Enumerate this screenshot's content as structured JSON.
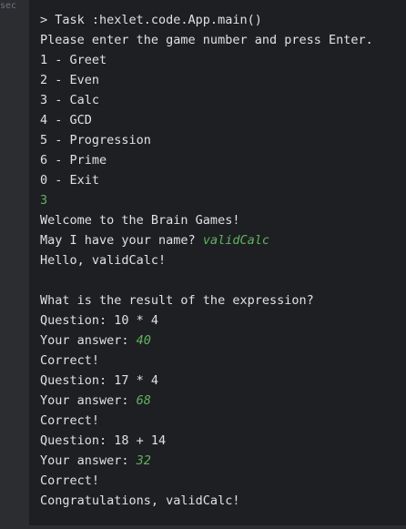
{
  "gutter": {
    "label": "sec"
  },
  "colors": {
    "background": "#1e1f22",
    "gutter": "#2b2d30",
    "text": "#dfe1e5",
    "user_input": "#5fb35f"
  },
  "console": {
    "lines": [
      {
        "text": "> Task :hexlet.code.App.main()"
      },
      {
        "text": "Please enter the game number and press Enter."
      },
      {
        "text": "1 - Greet"
      },
      {
        "text": "2 - Even"
      },
      {
        "text": "3 - Calc"
      },
      {
        "text": "4 - GCD"
      },
      {
        "text": "5 - Progression"
      },
      {
        "text": "6 - Prime"
      },
      {
        "text": "0 - Exit"
      },
      {
        "input": "3"
      },
      {
        "text": "Welcome to the Brain Games!"
      },
      {
        "text": "May I have your name? ",
        "input": "validCalc"
      },
      {
        "text": "Hello, validCalc!"
      },
      {
        "text": ""
      },
      {
        "text": "What is the result of the expression?"
      },
      {
        "text": "Question: 10 * 4"
      },
      {
        "text": "Your answer: ",
        "input": "40"
      },
      {
        "text": "Correct!"
      },
      {
        "text": "Question: 17 * 4"
      },
      {
        "text": "Your answer: ",
        "input": "68"
      },
      {
        "text": "Correct!"
      },
      {
        "text": "Question: 18 + 14"
      },
      {
        "text": "Your answer: ",
        "input": "32"
      },
      {
        "text": "Correct!"
      },
      {
        "text": "Congratulations, validCalc!"
      }
    ]
  }
}
